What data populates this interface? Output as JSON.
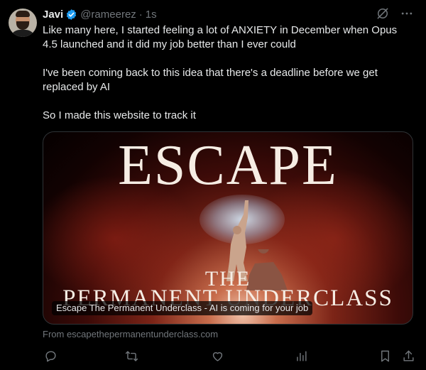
{
  "author": {
    "name": "Javi",
    "handle": "@rameerez",
    "separator": "·",
    "time": "1s",
    "verified_icon": "verified-badge-icon",
    "verified_color": "#1d9bf0"
  },
  "tweet": {
    "paragraphs": [
      "Like many here, I started feeling a lot of ANXIETY in December when Opus 4.5 launched and it did my job better than I ever could",
      "I've been coming back to this idea that there's a deadline before we get replaced by AI",
      "So I made this website to track it"
    ]
  },
  "card": {
    "headline": "ESCAPE",
    "sub_line1": "THE",
    "sub_line2": "PERMANENT UNDERCLASS",
    "caption": "Escape The Permanent Underclass - AI is coming for your job",
    "source": "From escapethepermanentunderclass.com"
  },
  "icons": {
    "top": [
      "grok-icon",
      "more-icon"
    ],
    "actions": [
      "reply-icon",
      "retweet-icon",
      "like-icon",
      "views-icon",
      "bookmark-icon",
      "share-icon"
    ]
  },
  "colors": {
    "background": "#000000",
    "text": "#e7e9ea",
    "secondary": "#71767b",
    "border": "#2f3336"
  }
}
